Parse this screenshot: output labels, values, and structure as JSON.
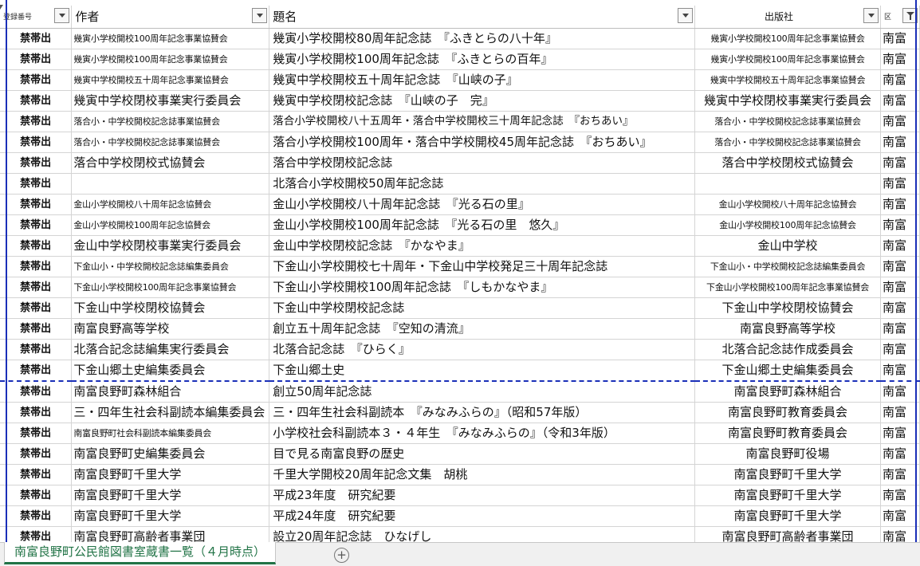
{
  "headers": {
    "col0": "登録番号",
    "col1": "作者",
    "col2": "題名",
    "col3": "出版社",
    "col4": "区"
  },
  "rows": [
    {
      "status": "禁帯出",
      "author": "幾寅小学校開校100周年記念事業協賛会",
      "title": "幾寅小学校開校80周年記念誌　『ふきとらの八十年』",
      "publisher": "幾寅小学校開校100周年記念事業協賛会",
      "area": "南富"
    },
    {
      "status": "禁帯出",
      "author": "幾寅小学校開校100周年記念事業協賛会",
      "title": "幾寅小学校開校100周年記念誌　『ふきとらの百年』",
      "publisher": "幾寅小学校開校100周年記念事業協賛会",
      "area": "南富"
    },
    {
      "status": "禁帯出",
      "author": "幾寅中学校開校五十周年記念事業協賛会",
      "title": "幾寅中学校開校五十周年記念誌　『山峡の子』",
      "publisher": "幾寅中学校開校五十周年記念事業協賛会",
      "area": "南富"
    },
    {
      "status": "禁帯出",
      "author": "幾寅中学校閉校事業実行委員会",
      "title": "幾寅中学校閉校記念誌　『山峡の子　完』",
      "publisher": "幾寅中学校閉校事業実行委員会",
      "area": "南富"
    },
    {
      "status": "禁帯出",
      "author": "落合小・中学校開校記念誌事業協賛会",
      "title": "落合小学校開校八十五周年・落合中学校開校三十周年記念誌　『おちあい』",
      "publisher": "落合小・中学校開校記念誌事業協賛会",
      "area": "南富"
    },
    {
      "status": "禁帯出",
      "author": "落合小・中学校開校記念誌事業協賛会",
      "title": "落合小学校開校100周年・落合中学校開校45周年記念誌　『おちあい』",
      "publisher": "落合小・中学校開校記念誌事業協賛会",
      "area": "南富"
    },
    {
      "status": "禁帯出",
      "author": "落合中学校閉校式協賛会",
      "title": "落合中学校閉校記念誌",
      "publisher": "落合中学校閉校式協賛会",
      "area": "南富"
    },
    {
      "status": "禁帯出",
      "author": "",
      "title": "北落合小学校開校50周年記念誌",
      "publisher": "",
      "area": "南富"
    },
    {
      "status": "禁帯出",
      "author": "金山小学校開校八十周年記念協賛会",
      "title": "金山小学校開校八十周年記念誌　『光る石の里』",
      "publisher": "金山小学校開校八十周年記念協賛会",
      "area": "南富"
    },
    {
      "status": "禁帯出",
      "author": "金山小学校開校100周年記念協賛会",
      "title": "金山小学校開校100周年記念誌　『光る石の里　悠久』",
      "publisher": "金山小学校開校100周年記念協賛会",
      "area": "南富"
    },
    {
      "status": "禁帯出",
      "author": "金山中学校閉校事業実行委員会",
      "title": "金山中学校閉校記念誌　『かなやま』",
      "publisher": "金山中学校",
      "area": "南富"
    },
    {
      "status": "禁帯出",
      "author": "下金山小・中学校開校記念誌編集委員会",
      "title": "下金山小学校開校七十周年・下金山中学校発足三十周年記念誌",
      "publisher": "下金山小・中学校開校記念誌編集委員会",
      "area": "南富"
    },
    {
      "status": "禁帯出",
      "author": "下金山小学校開校100周年記念事業協賛会",
      "title": "下金山小学校開校100周年記念誌　『しもかなやま』",
      "publisher": "下金山小学校開校100周年記念事業協賛会",
      "area": "南富"
    },
    {
      "status": "禁帯出",
      "author": "下金山中学校閉校協賛会",
      "title": "下金山中学校閉校記念誌",
      "publisher": "下金山中学校閉校協賛会",
      "area": "南富"
    },
    {
      "status": "禁帯出",
      "author": "南富良野高等学校",
      "title": "創立五十周年記念誌　『空知の清流』",
      "publisher": "南富良野高等学校",
      "area": "南富"
    },
    {
      "status": "禁帯出",
      "author": "北落合記念誌編集実行委員会",
      "title": "北落合記念誌　『ひらく』",
      "publisher": "北落合記念誌作成委員会",
      "area": "南富"
    },
    {
      "status": "禁帯出",
      "author": "下金山郷土史編集委員会",
      "title": "下金山郷土史",
      "publisher": "下金山郷土史編集委員会",
      "area": "南富"
    },
    {
      "status": "禁帯出",
      "author": "南富良野町森林組合",
      "title": "創立50周年記念誌",
      "publisher": "南富良野町森林組合",
      "area": "南富"
    },
    {
      "status": "禁帯出",
      "author": "三・四年生社会科副読本編集委員会",
      "title": "三・四年生社会科副読本　『みなみふらの』（昭和57年版）",
      "publisher": "南富良野町教育委員会",
      "area": "南富"
    },
    {
      "status": "禁帯出",
      "author": "南富良野町社会科副読本編集委員会",
      "title": "小学校社会科副読本３・４年生　『みなみふらの』（令和3年版）",
      "publisher": "南富良野町教育委員会",
      "area": "南富"
    },
    {
      "status": "禁帯出",
      "author": "南富良野町史編集委員会",
      "title": "目で見る南富良野の歴史",
      "publisher": "南富良野町役場",
      "area": "南富"
    },
    {
      "status": "禁帯出",
      "author": "南富良野町千里大学",
      "title": "千里大学開校20周年記念文集　胡桃",
      "publisher": "南富良野町千里大学",
      "area": "南富"
    },
    {
      "status": "禁帯出",
      "author": "南富良野町千里大学",
      "title": "平成23年度　研究紀要",
      "publisher": "南富良野町千里大学",
      "area": "南富"
    },
    {
      "status": "禁帯出",
      "author": "南富良野町千里大学",
      "title": "平成24年度　研究紀要",
      "publisher": "南富良野町千里大学",
      "area": "南富"
    },
    {
      "status": "禁帯出",
      "author": "南富良野町高齢者事業団",
      "title": "設立20周年記念誌　ひなげし",
      "publisher": "南富良野町高齢者事業団",
      "area": "南富"
    }
  ],
  "sheet_tab": "南富良野町公民館図書室蔵書一覧（４月時点）",
  "add_sheet": "+"
}
